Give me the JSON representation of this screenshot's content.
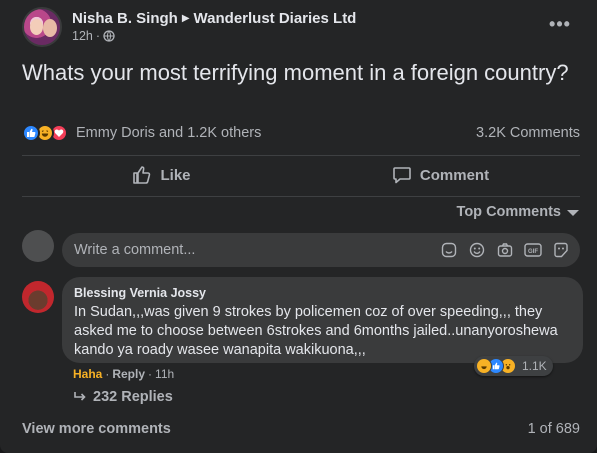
{
  "post": {
    "author": "Nisha B. Singh",
    "group": "Wanderlust Diaries Ltd",
    "time": "12h",
    "more_label": "•••",
    "text": "Whats your most terrifying moment in a foreign country?"
  },
  "reactions": {
    "summary": "Emmy Doris and 1.2K others",
    "comments_count": "3.2K Comments",
    "colors": {
      "like": "#2d88ff",
      "haha": "#f7b125",
      "love": "#f33e58"
    }
  },
  "actions": {
    "like": "Like",
    "comment": "Comment"
  },
  "comments_header": {
    "sort_label": "Top Comments"
  },
  "composer": {
    "placeholder": "Write a comment...",
    "tools": [
      "sticker-icon",
      "emoji-icon",
      "camera-icon",
      "gif-icon",
      "avatar-sticker-icon"
    ]
  },
  "comment": {
    "author": "Blessing Vernia Jossy",
    "text": "In Sudan,,,was given 9 strokes by policemen coz of over speeding,,, they asked me to choose between 6strokes and 6months jailed..unanyoroshewa kando ya roady wasee wanapita wakikuona,,,",
    "reaction_count": "1.1K",
    "reacted_label": "Haha",
    "reply_label": "Reply",
    "time": "11h",
    "replies": "232 Replies"
  },
  "footer": {
    "view_more": "View more comments",
    "pagination": "1 of 689"
  }
}
